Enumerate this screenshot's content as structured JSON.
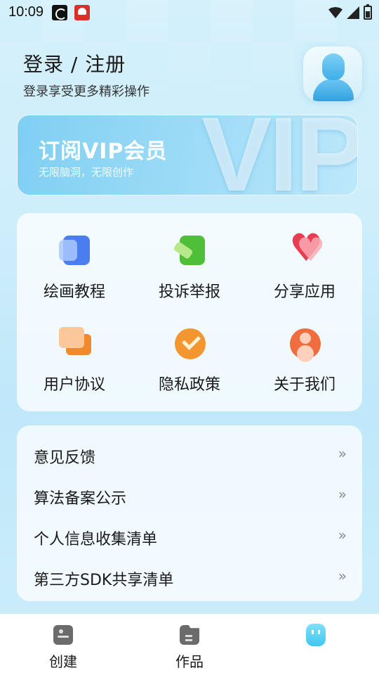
{
  "status_bar": {
    "time": "10:09"
  },
  "header": {
    "title": "登录 / 注册",
    "subtitle": "登录享受更多精彩操作"
  },
  "vip": {
    "watermark": "VIP",
    "title": "订阅VIP会员",
    "subtitle": "无限脑洞，无限创作"
  },
  "grid": {
    "items": [
      {
        "label": "绘画教程",
        "icon": "tutorial-icon"
      },
      {
        "label": "投诉举报",
        "icon": "report-icon"
      },
      {
        "label": "分享应用",
        "icon": "heart-share-icon"
      },
      {
        "label": "用户协议",
        "icon": "chat-bubble-icon"
      },
      {
        "label": "隐私政策",
        "icon": "check-shield-icon"
      },
      {
        "label": "关于我们",
        "icon": "person-icon"
      }
    ]
  },
  "list": {
    "items": [
      {
        "label": "意见反馈",
        "arrow": "»"
      },
      {
        "label": "算法备案公示",
        "arrow": "»"
      },
      {
        "label": "个人信息收集清单",
        "arrow": "»"
      },
      {
        "label": "第三方SDK共享清单",
        "arrow": "»"
      }
    ]
  },
  "bottom_nav": {
    "items": [
      {
        "label": "创建",
        "icon": "image-icon"
      },
      {
        "label": "作品",
        "icon": "folder-icon"
      },
      {
        "label": "",
        "icon": "mine-icon"
      }
    ],
    "active_index": 2,
    "active_color": "#3fc7f0"
  }
}
